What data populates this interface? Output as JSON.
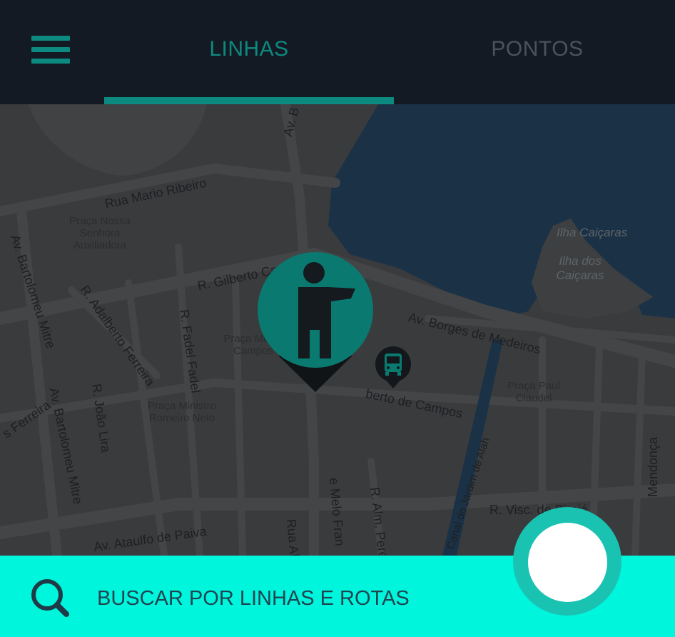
{
  "header": {
    "tabs": [
      {
        "label": "LINHAS",
        "active": true
      },
      {
        "label": "PONTOS",
        "active": false
      }
    ],
    "menu_icon": "hamburger-menu-icon"
  },
  "map": {
    "streets": [
      "Av. B",
      "Rua Mario Ribeiro",
      "R. Gilberto Cardoso",
      "Av. Bartolomeu Mitre",
      "R. Adalberto Ferreira",
      "R. Fadel Fadel",
      "Av. Borges de Medeiros",
      "berto de Campos",
      "R. João Lira",
      "Av. Bartolomeu Mitre",
      "s Ferreira",
      "Av. Ataulfo de Paiva",
      "R. Visc. de Pirajá",
      "R. Alm. Perei",
      "e Melo Fran",
      "Rua Al",
      "Mendonça",
      "Canal do Jardim de Alah"
    ],
    "places": [
      "Praça Nossa Senhora Auxiliadora",
      "Praça Milton Campos",
      "Praça Ministro Romeiro Neto",
      "Praça Paul Claudel"
    ],
    "islands": [
      "Ilha Caiçaras",
      "Ilha dos Caiçaras"
    ],
    "pins": [
      {
        "type": "hail-bus-stop",
        "icon": "person-hailing-icon"
      },
      {
        "type": "bus",
        "icon": "bus-icon"
      }
    ],
    "colors": {
      "water": "#1b3246",
      "land": "#3a3b3d",
      "roads": "#444547"
    }
  },
  "search": {
    "placeholder": "BUSCAR POR LINHAS E ROTAS",
    "icon": "search-icon"
  },
  "colors": {
    "accent": "#0d8a80",
    "topbar": "#141a23",
    "bottombar": "#00f5dd",
    "inactive_tab": "#4a525c"
  }
}
